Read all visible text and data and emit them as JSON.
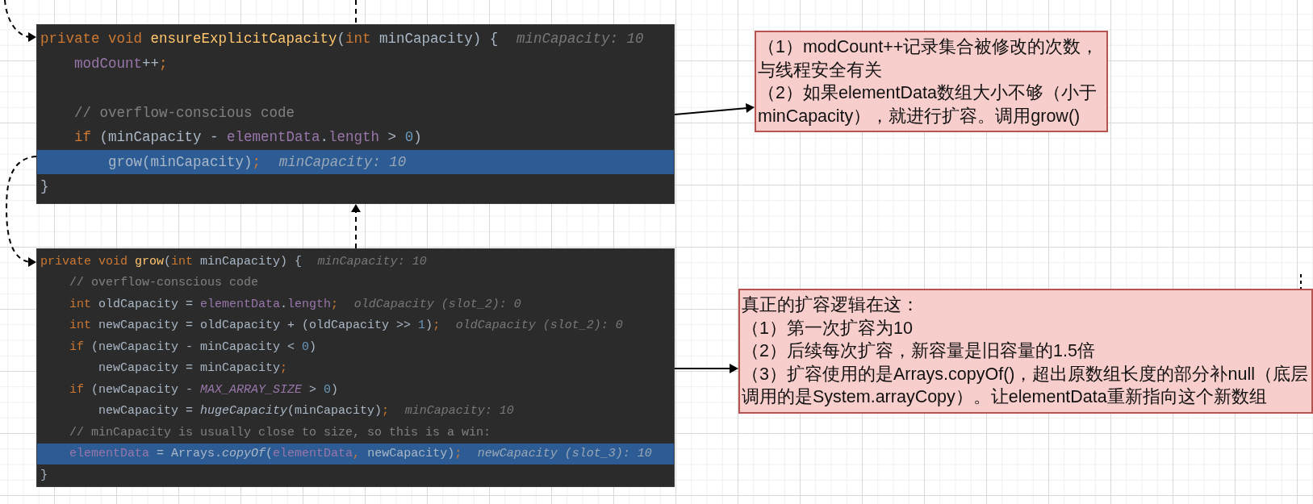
{
  "canvas": {
    "code_panels": [
      {
        "lines": [
          {
            "tokens": [
              {
                "text": "private void ",
                "kind": "keyword"
              },
              {
                "text": "ensureExplicitCapacity",
                "kind": "method"
              },
              {
                "text": "(",
                "kind": "plain"
              },
              {
                "text": "int",
                "kind": "keyword"
              },
              {
                "text": " minCapacity) {",
                "kind": "plain"
              }
            ],
            "hint": "minCapacity: 10",
            "selected": false
          },
          {
            "tokens": [
              {
                "text": "    modCount",
                "kind": "field"
              },
              {
                "text": "++",
                "kind": "plain"
              },
              {
                "text": ";",
                "kind": "punct"
              }
            ],
            "selected": false
          },
          {
            "selected": false
          },
          {
            "tokens": [
              {
                "text": "    // overflow-conscious code",
                "kind": "comment"
              }
            ],
            "selected": false
          },
          {
            "tokens": [
              {
                "text": "    if",
                "kind": "keyword"
              },
              {
                "text": " (minCapacity - ",
                "kind": "plain"
              },
              {
                "text": "elementData",
                "kind": "field"
              },
              {
                "text": ".",
                "kind": "plain"
              },
              {
                "text": "length",
                "kind": "field"
              },
              {
                "text": " > ",
                "kind": "plain"
              },
              {
                "text": "0",
                "kind": "number"
              },
              {
                "text": ")",
                "kind": "plain"
              }
            ],
            "selected": false
          },
          {
            "tokens": [
              {
                "text": "        grow(minCapacity)",
                "kind": "plain"
              },
              {
                "text": ";",
                "kind": "punct"
              }
            ],
            "hint": "minCapacity: 10",
            "selected": true
          },
          {
            "tokens": [
              {
                "text": "}",
                "kind": "plain"
              }
            ],
            "selected": false
          }
        ]
      },
      {
        "lines": [
          {
            "tokens": [
              {
                "text": "private void ",
                "kind": "keyword"
              },
              {
                "text": "grow",
                "kind": "method"
              },
              {
                "text": "(",
                "kind": "plain"
              },
              {
                "text": "int",
                "kind": "keyword"
              },
              {
                "text": " minCapacity) {",
                "kind": "plain"
              }
            ],
            "hint": "minCapacity: 10",
            "selected": false
          },
          {
            "tokens": [
              {
                "text": "    // overflow-conscious code",
                "kind": "comment"
              }
            ],
            "selected": false
          },
          {
            "tokens": [
              {
                "text": "    int",
                "kind": "keyword"
              },
              {
                "text": " oldCapacity = ",
                "kind": "plain"
              },
              {
                "text": "elementData",
                "kind": "field"
              },
              {
                "text": ".",
                "kind": "plain"
              },
              {
                "text": "length",
                "kind": "field"
              },
              {
                "text": ";",
                "kind": "punct"
              }
            ],
            "hint": "oldCapacity (slot_2): 0",
            "selected": false
          },
          {
            "tokens": [
              {
                "text": "    int",
                "kind": "keyword"
              },
              {
                "text": " newCapacity = oldCapacity + (oldCapacity >> ",
                "kind": "plain"
              },
              {
                "text": "1",
                "kind": "number"
              },
              {
                "text": ")",
                "kind": "plain"
              },
              {
                "text": ";",
                "kind": "punct"
              }
            ],
            "hint": "oldCapacity (slot_2): 0",
            "selected": false
          },
          {
            "tokens": [
              {
                "text": "    if",
                "kind": "keyword"
              },
              {
                "text": " (newCapacity - minCapacity < ",
                "kind": "plain"
              },
              {
                "text": "0",
                "kind": "number"
              },
              {
                "text": ")",
                "kind": "plain"
              }
            ],
            "selected": false
          },
          {
            "tokens": [
              {
                "text": "        newCapacity = minCapacity",
                "kind": "plain"
              },
              {
                "text": ";",
                "kind": "punct"
              }
            ],
            "selected": false
          },
          {
            "tokens": [
              {
                "text": "    if",
                "kind": "keyword"
              },
              {
                "text": " (newCapacity - ",
                "kind": "plain"
              },
              {
                "text": "MAX_ARRAY_SIZE",
                "kind": "constant"
              },
              {
                "text": " > ",
                "kind": "plain"
              },
              {
                "text": "0",
                "kind": "number"
              },
              {
                "text": ")",
                "kind": "plain"
              }
            ],
            "selected": false
          },
          {
            "tokens": [
              {
                "text": "        newCapacity = ",
                "kind": "plain"
              },
              {
                "text": "hugeCapacity",
                "kind": "call"
              },
              {
                "text": "(minCapacity)",
                "kind": "plain"
              },
              {
                "text": ";",
                "kind": "punct"
              }
            ],
            "hint": "minCapacity: 10",
            "selected": false
          },
          {
            "tokens": [
              {
                "text": "    // minCapacity is usually close to size, so this is a win:",
                "kind": "comment"
              }
            ],
            "selected": false
          },
          {
            "tokens": [
              {
                "text": "    elementData",
                "kind": "field"
              },
              {
                "text": " = Arrays.",
                "kind": "plain"
              },
              {
                "text": "copyOf",
                "kind": "call"
              },
              {
                "text": "(",
                "kind": "plain"
              },
              {
                "text": "elementData",
                "kind": "field"
              },
              {
                "text": ", ",
                "kind": "punct"
              },
              {
                "text": "newCapacity)",
                "kind": "plain"
              },
              {
                "text": ";",
                "kind": "punct"
              }
            ],
            "hint": "newCapacity (slot_3): 10",
            "selected": true
          },
          {
            "tokens": [
              {
                "text": "}",
                "kind": "plain"
              }
            ],
            "selected": false
          }
        ]
      }
    ],
    "notes": [
      {
        "lines": [
          "（1）modCount++记录集合被修改的次数，与线程安全有关",
          "（2）如果elementData数组大小不够（小于minCapacity），就进行扩容。调用grow()"
        ]
      },
      {
        "lines": [
          "真正的扩容逻辑在这：",
          "（1）第一次扩容为10",
          "（2）后续每次扩容，新容量是旧容量的1.5倍",
          "（3）扩容使用的是Arrays.copyOf()，超出原数组长度的部分补null（底层调用的是System.arrayCopy）。让elementData重新指向这个新数组"
        ]
      }
    ]
  }
}
